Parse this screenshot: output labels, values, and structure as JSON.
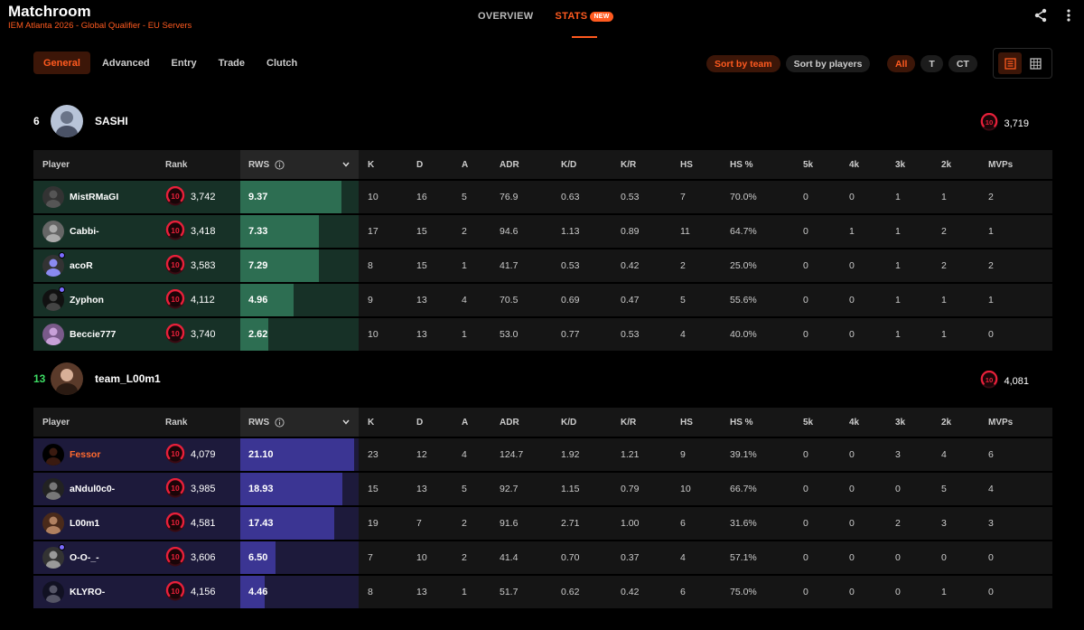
{
  "header": {
    "title": "Matchroom",
    "subtitle": "IEM Atlanta 2026 - Global Qualifier - EU Servers",
    "tabs": [
      {
        "label": "OVERVIEW"
      },
      {
        "label": "STATS",
        "badge": "NEW"
      }
    ]
  },
  "toolbar": {
    "subtabs": [
      "General",
      "Advanced",
      "Entry",
      "Trade",
      "Clutch"
    ],
    "sort_team": "Sort by team",
    "sort_players": "Sort by players",
    "side_all": "All",
    "side_t": "T",
    "side_ct": "CT"
  },
  "columns": {
    "player": "Player",
    "rank": "Rank",
    "rws": "RWS",
    "k": "K",
    "d": "D",
    "a": "A",
    "adr": "ADR",
    "kd": "K/D",
    "kr": "K/R",
    "hs": "HS",
    "hsp": "HS %",
    "k5": "5k",
    "k4": "4k",
    "k3": "3k",
    "k2": "2k",
    "mvps": "MVPs"
  },
  "level_badge": "10",
  "colors": {
    "accent": "#ff5a1f",
    "team_a": "#2d6e52",
    "team_b": "#3b3593",
    "level": "#e8203a"
  },
  "teams": [
    {
      "score": "6",
      "score_color": "#ffffff",
      "name": "SASHI",
      "elo": "3,719",
      "players": [
        {
          "name": "MistRMaGI",
          "elo": "3,742",
          "rws": "9.37",
          "rws_num": 9.37,
          "k": "10",
          "d": "16",
          "a": "5",
          "adr": "76.9",
          "kd": "0.63",
          "kr": "0.53",
          "hs": "7",
          "hsp": "70.0%",
          "k5": "0",
          "k4": "0",
          "k3": "1",
          "k2": "1",
          "mvps": "2"
        },
        {
          "name": "Cabbi-",
          "elo": "3,418",
          "rws": "7.33",
          "rws_num": 7.33,
          "k": "17",
          "d": "15",
          "a": "2",
          "adr": "94.6",
          "kd": "1.13",
          "kr": "0.89",
          "hs": "11",
          "hsp": "64.7%",
          "k5": "0",
          "k4": "1",
          "k3": "1",
          "k2": "2",
          "mvps": "1"
        },
        {
          "name": "acoR",
          "elo": "3,583",
          "rws": "7.29",
          "rws_num": 7.29,
          "k": "8",
          "d": "15",
          "a": "1",
          "adr": "41.7",
          "kd": "0.53",
          "kr": "0.42",
          "hs": "2",
          "hsp": "25.0%",
          "k5": "0",
          "k4": "0",
          "k3": "1",
          "k2": "2",
          "mvps": "2"
        },
        {
          "name": "Zyphon",
          "elo": "4,112",
          "rws": "4.96",
          "rws_num": 4.96,
          "k": "9",
          "d": "13",
          "a": "4",
          "adr": "70.5",
          "kd": "0.69",
          "kr": "0.47",
          "hs": "5",
          "hsp": "55.6%",
          "k5": "0",
          "k4": "0",
          "k3": "1",
          "k2": "1",
          "mvps": "1"
        },
        {
          "name": "Beccie777",
          "elo": "3,740",
          "rws": "2.62",
          "rws_num": 2.62,
          "k": "10",
          "d": "13",
          "a": "1",
          "adr": "53.0",
          "kd": "0.77",
          "kr": "0.53",
          "hs": "4",
          "hsp": "40.0%",
          "k5": "0",
          "k4": "0",
          "k3": "1",
          "k2": "1",
          "mvps": "0"
        }
      ]
    },
    {
      "score": "13",
      "score_color": "#3ddc64",
      "name": "team_L00m1",
      "elo": "4,081",
      "players": [
        {
          "name": "Fessor",
          "elo": "4,079",
          "rws": "21.10",
          "rws_num": 21.1,
          "k": "23",
          "d": "12",
          "a": "4",
          "adr": "124.7",
          "kd": "1.92",
          "kr": "1.21",
          "hs": "9",
          "hsp": "39.1%",
          "k5": "0",
          "k4": "0",
          "k3": "3",
          "k2": "4",
          "mvps": "6"
        },
        {
          "name": "aNdul0c0-",
          "elo": "3,985",
          "rws": "18.93",
          "rws_num": 18.93,
          "k": "15",
          "d": "13",
          "a": "5",
          "adr": "92.7",
          "kd": "1.15",
          "kr": "0.79",
          "hs": "10",
          "hsp": "66.7%",
          "k5": "0",
          "k4": "0",
          "k3": "0",
          "k2": "5",
          "mvps": "4"
        },
        {
          "name": "L00m1",
          "elo": "4,581",
          "rws": "17.43",
          "rws_num": 17.43,
          "k": "19",
          "d": "7",
          "a": "2",
          "adr": "91.6",
          "kd": "2.71",
          "kr": "1.00",
          "hs": "6",
          "hsp": "31.6%",
          "k5": "0",
          "k4": "0",
          "k3": "2",
          "k2": "3",
          "mvps": "3"
        },
        {
          "name": "Ο-Ο-_-",
          "elo": "3,606",
          "rws": "6.50",
          "rws_num": 6.5,
          "k": "7",
          "d": "10",
          "a": "2",
          "adr": "41.4",
          "kd": "0.70",
          "kr": "0.37",
          "hs": "4",
          "hsp": "57.1%",
          "k5": "0",
          "k4": "0",
          "k3": "0",
          "k2": "0",
          "mvps": "0"
        },
        {
          "name": "KLYRO-",
          "elo": "4,156",
          "rws": "4.46",
          "rws_num": 4.46,
          "k": "8",
          "d": "13",
          "a": "1",
          "adr": "51.7",
          "kd": "0.62",
          "kr": "0.42",
          "hs": "6",
          "hsp": "75.0%",
          "k5": "0",
          "k4": "0",
          "k3": "0",
          "k2": "1",
          "mvps": "0"
        }
      ]
    }
  ]
}
